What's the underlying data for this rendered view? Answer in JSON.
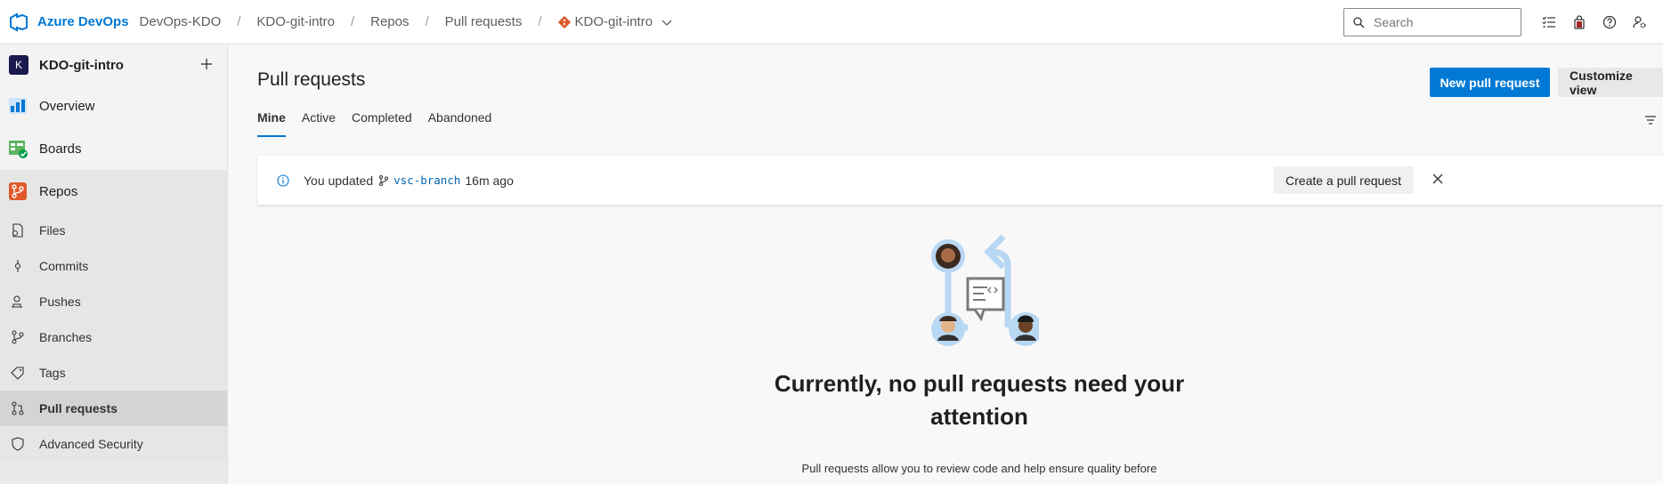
{
  "topbar": {
    "brand": "Azure DevOps",
    "breadcrumbs": [
      "DevOps-KDO",
      "KDO-git-intro",
      "Repos",
      "Pull requests"
    ],
    "separator": "/",
    "repo": "KDO-git-intro",
    "search_placeholder": "Search"
  },
  "sidebar": {
    "project_initial": "K",
    "project_name": "KDO-git-intro",
    "overview": "Overview",
    "boards": "Boards",
    "repos": "Repos",
    "sub_items": [
      "Files",
      "Commits",
      "Pushes",
      "Branches",
      "Tags",
      "Pull requests",
      "Advanced Security"
    ]
  },
  "main": {
    "title": "Pull requests",
    "new_pr_label": "New pull request",
    "customize_label": "Customize view",
    "tabs": [
      "Mine",
      "Active",
      "Completed",
      "Abandoned"
    ],
    "banner": {
      "prefix": "You updated",
      "branch": "vsc-branch",
      "suffix": "16m ago",
      "create_label": "Create a pull request"
    },
    "empty_title": "Currently, no pull requests need your attention",
    "empty_desc": "Pull requests allow you to review code and help ensure quality before"
  },
  "colors": {
    "accent": "#0078d4",
    "repos_icon": "#e05a2b",
    "boards_icon": "#009e49"
  }
}
